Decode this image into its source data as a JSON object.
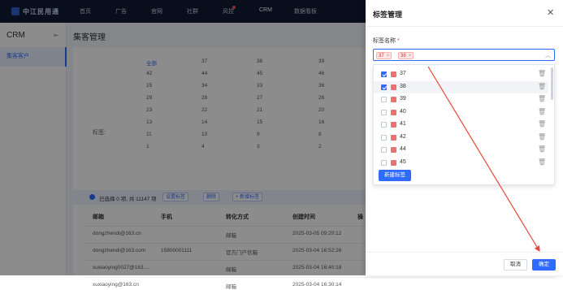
{
  "app": {
    "logo_text": "中江民用通",
    "nav": [
      "首页",
      "广告",
      "官网",
      "社群",
      "风控",
      "CRM",
      "数据看板"
    ],
    "nav_active": "CRM"
  },
  "sidebar": {
    "title": "CRM",
    "active_item": "集客客户"
  },
  "main": {
    "page_title": "集客管理",
    "filter_label": "标签:",
    "number_grid": [
      [
        "全部",
        "37",
        "38",
        "39"
      ],
      [
        "42",
        "44",
        "45",
        "46"
      ],
      [
        "25",
        "34",
        "33",
        "36"
      ],
      [
        "29",
        "28",
        "27",
        "26"
      ],
      [
        "23",
        "22",
        "21",
        "20"
      ],
      [
        "13",
        "14",
        "15",
        "16"
      ],
      [
        "11",
        "10",
        "9",
        "8"
      ],
      [
        "1",
        "4",
        "3",
        "2"
      ]
    ],
    "selection_text": "已选择 0 项, 共 11147 项",
    "toolbar_buttons": [
      "设置标签",
      "删除",
      "+ 新增标签"
    ],
    "table": {
      "headers": [
        "邮箱",
        "手机",
        "转化方式",
        "创建时间",
        "操"
      ],
      "rows": [
        [
          "dongzhendi@163.cn",
          "",
          "邮箱",
          "2025-03-05 09:20:12"
        ],
        [
          "dongzhendi@163.com",
          "15800001111",
          "官方门户信箱",
          "2025-03-04 16:52:26"
        ],
        [
          "xuxiaoying0027@163....",
          "",
          "邮箱",
          "2025-03-04 16:40:18"
        ],
        [
          "xuxiaoying@163.cn",
          "",
          "邮箱",
          "2025-03-04 16:30:14"
        ]
      ]
    }
  },
  "drawer": {
    "title": "标签管理",
    "field_label": "标签名称",
    "required_mark": "*",
    "selected_tags": [
      "37",
      "38"
    ],
    "options": [
      {
        "label": "37",
        "checked": true
      },
      {
        "label": "38",
        "checked": true
      },
      {
        "label": "39",
        "checked": false
      },
      {
        "label": "40",
        "checked": false
      },
      {
        "label": "41",
        "checked": false
      },
      {
        "label": "42",
        "checked": false
      },
      {
        "label": "44",
        "checked": false
      },
      {
        "label": "45",
        "checked": false
      }
    ],
    "new_tag_label": "新建标签",
    "cancel_label": "取消",
    "confirm_label": "确定",
    "tag_color": "#e8726f",
    "accent_color": "#2f6bff"
  }
}
